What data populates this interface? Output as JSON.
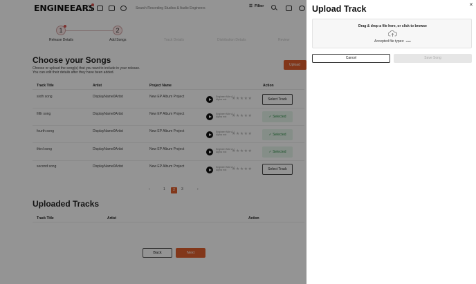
{
  "app": {
    "logo_text": "ENGINEEARS"
  },
  "topbar": {
    "search_placeholder": "Search Recording Studios & Audio Engineers",
    "filter_label": "Filter",
    "icons": [
      "bell-icon",
      "folder-icon",
      "mail-icon",
      "network-icon",
      "search-icon",
      "notes-icon",
      "people-icon"
    ]
  },
  "stepper": {
    "steps": [
      {
        "number": "1",
        "label": "Release Details"
      },
      {
        "number": "2",
        "label": "Add Songs"
      },
      {
        "number": "",
        "label": "Track Details"
      },
      {
        "number": "",
        "label": "Distribution Details"
      },
      {
        "number": "",
        "label": "Review"
      }
    ]
  },
  "songs_section": {
    "title": "Choose your Songs",
    "description": "Choose or upload the song(s) that you want to include in your release. You can edit their details after they have been added.",
    "upload_label": "Upload",
    "columns": [
      "Track Title",
      "Artist",
      "Project Name",
      "",
      "Action"
    ],
    "rows": [
      {
        "title": "sixth song",
        "artist": "DisplayName0Artist",
        "project": "New EP Album Project",
        "waveform_label": "Engineer Mix v1 | Alpha mix",
        "action": "Select Track",
        "selected": false
      },
      {
        "title": "fifth song",
        "artist": "DisplayName0Artist",
        "project": "New EP Album Project",
        "waveform_label": "Engineer Mix v1 | Alpha mix",
        "action": "Selected",
        "selected": true
      },
      {
        "title": "fourth song",
        "artist": "DisplayName0Artist",
        "project": "New EP Album Project",
        "waveform_label": "Engineer Mix v1 | Alpha mix",
        "action": "Selected",
        "selected": true
      },
      {
        "title": "third song",
        "artist": "DisplayName0Artist",
        "project": "New EP Album Project",
        "waveform_label": "Engineer Mix v1 | Alpha mix",
        "action": "Selected",
        "selected": true
      },
      {
        "title": "second song",
        "artist": "DisplayName0Artist",
        "project": "New EP Album Project",
        "waveform_label": "Engineer Mix v1 | Alpha mix",
        "action": "Select Track",
        "selected": false
      }
    ],
    "pagination": {
      "prev": "‹",
      "pages": [
        "1",
        "2",
        "3"
      ],
      "current": "2",
      "next": "›"
    }
  },
  "uploaded_section": {
    "title": "Uploaded Tracks",
    "columns": [
      "Track Title",
      "Artist",
      "Action"
    ]
  },
  "footer": {
    "back_label": "Back",
    "next_label": "Next"
  },
  "drawer": {
    "title": "Upload Track",
    "close_glyph": "✕",
    "dropzone_text": "Drag & drop a file here, or click to browse",
    "accepted_label": "Accepted file types:",
    "accepted_ext": ".wav",
    "cancel_label": "Cancel",
    "save_label": "Save Song"
  },
  "colors": {
    "accent": "#e0602d",
    "selected_green": "#2f8f4a",
    "overlay": "rgba(0,0,0,0.42)"
  }
}
